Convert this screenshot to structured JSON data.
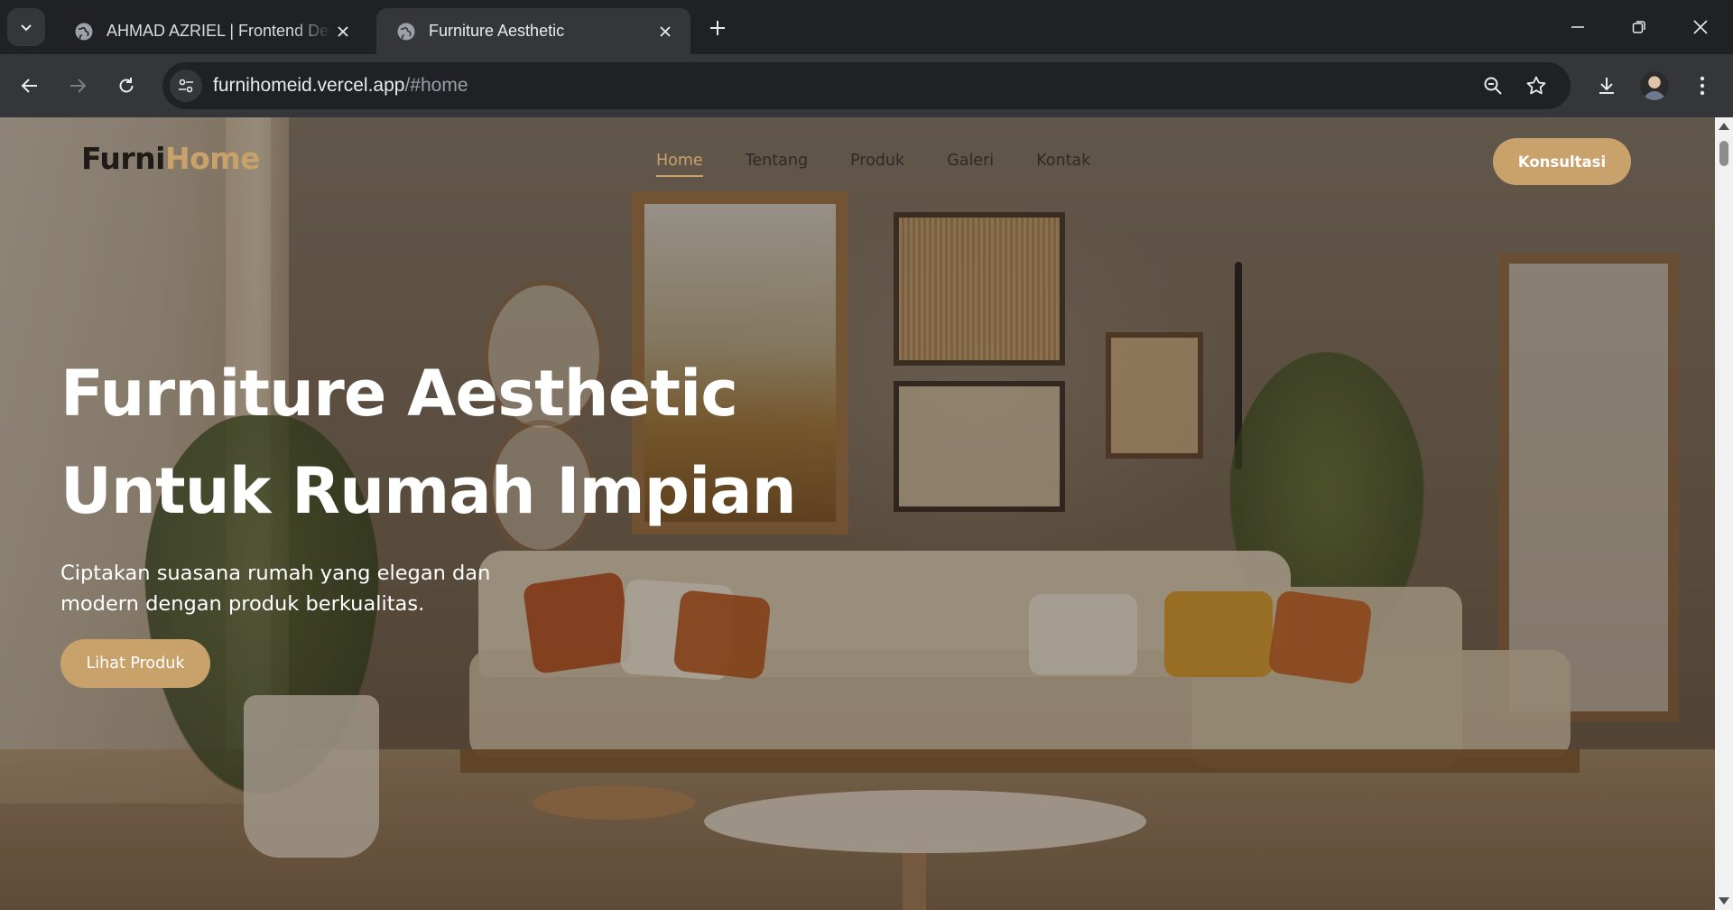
{
  "browser": {
    "tabs": [
      {
        "title": "AHMAD AZRIEL | Frontend Dev",
        "active": false
      },
      {
        "title": "Furniture Aesthetic",
        "active": true
      }
    ],
    "address": {
      "host": "furnihomeid.vercel.app",
      "path": "/#home"
    }
  },
  "site": {
    "logo": {
      "part1": "Furni",
      "part2": "Home"
    },
    "nav": [
      {
        "label": "Home",
        "active": true
      },
      {
        "label": "Tentang",
        "active": false
      },
      {
        "label": "Produk",
        "active": false
      },
      {
        "label": "Galeri",
        "active": false
      },
      {
        "label": "Kontak",
        "active": false
      }
    ],
    "cta_top": "Konsultasi",
    "hero": {
      "title_line1": "Furniture Aesthetic",
      "title_line2": "Untuk Rumah Impian",
      "subtitle_line1": "Ciptakan suasana rumah yang elegan dan",
      "subtitle_line2": "modern dengan produk berkualitas.",
      "cta": "Lihat Produk"
    }
  },
  "colors": {
    "accent": "#c9a26b",
    "logo_dark": "#1d1a17",
    "chrome_dark": "#202124",
    "chrome_toolbar": "#35363a"
  },
  "icons": [
    "tab-search-icon",
    "globe-icon",
    "close-icon",
    "plus-icon",
    "minimize-icon",
    "restore-icon",
    "back-icon",
    "forward-icon",
    "reload-icon",
    "site-info-icon",
    "zoom-icon",
    "star-icon",
    "download-icon",
    "menu-icon"
  ]
}
